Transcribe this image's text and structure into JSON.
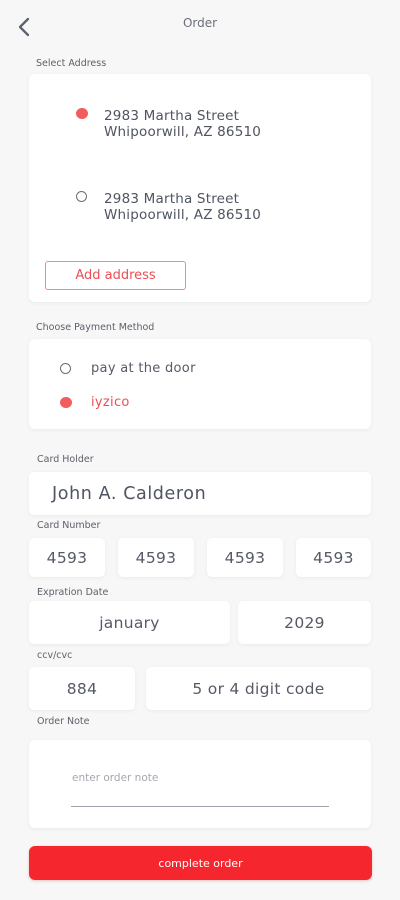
{
  "header": {
    "title": "Order"
  },
  "address": {
    "section_label": "Select Address",
    "options": [
      {
        "line1": "2983 Martha Street",
        "line2": "Whipoorwill, AZ 86510",
        "selected": true
      },
      {
        "line1": "2983 Martha Street",
        "line2": "Whipoorwill, AZ 86510",
        "selected": false
      }
    ],
    "add_label": "Add address"
  },
  "payment": {
    "section_label": "Choose Payment Method",
    "options": [
      {
        "label": "pay at the door",
        "selected": false
      },
      {
        "label": "iyzico",
        "selected": true
      }
    ]
  },
  "card": {
    "holder_label": "Card Holder",
    "holder_value": "John A. Calderon",
    "number_label": "Card Number",
    "number_groups": [
      "4593",
      "4593",
      "4593",
      "4593"
    ],
    "expiry_label": "Expration Date",
    "expiry_month": "january",
    "expiry_year": "2029",
    "cvv_label": "ccv/cvc",
    "cvv_value": "884",
    "cvv_hint": "5 or 4 digit code"
  },
  "note": {
    "section_label": "Order Note",
    "placeholder": "enter order note"
  },
  "submit": {
    "label": "complete order"
  },
  "colors": {
    "accent": "#f25c5c",
    "submit": "#f6262f",
    "background": "#f7f7f7"
  },
  "icons": {
    "back": "chevron-left-icon"
  }
}
